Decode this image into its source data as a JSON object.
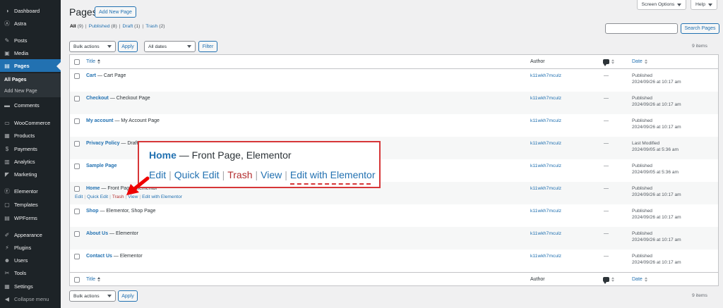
{
  "sidebar": {
    "items": [
      {
        "label": "Dashboard",
        "icon": "dashboard-icon",
        "glyph": "◑"
      },
      {
        "label": "Astra",
        "icon": "astra-icon",
        "glyph": "Ⓐ"
      },
      {
        "label": "Posts",
        "icon": "pin-icon",
        "glyph": "✎"
      },
      {
        "label": "Media",
        "icon": "media-icon",
        "glyph": "▣"
      },
      {
        "label": "Pages",
        "icon": "pages-icon",
        "glyph": "▤"
      },
      {
        "label": "Comments",
        "icon": "comments-icon",
        "glyph": "▬"
      },
      {
        "label": "WooCommerce",
        "icon": "woocommerce-icon",
        "glyph": "▭"
      },
      {
        "label": "Products",
        "icon": "products-icon",
        "glyph": "▦"
      },
      {
        "label": "Payments",
        "icon": "payments-icon",
        "glyph": "$"
      },
      {
        "label": "Analytics",
        "icon": "analytics-icon",
        "glyph": "▥"
      },
      {
        "label": "Marketing",
        "icon": "marketing-icon",
        "glyph": "◤"
      },
      {
        "label": "Elementor",
        "icon": "elementor-icon",
        "glyph": "Ⓔ"
      },
      {
        "label": "Templates",
        "icon": "templates-icon",
        "glyph": "▢"
      },
      {
        "label": "WPForms",
        "icon": "wpforms-icon",
        "glyph": "▤"
      },
      {
        "label": "Appearance",
        "icon": "appearance-icon",
        "glyph": "✐"
      },
      {
        "label": "Plugins",
        "icon": "plugins-icon",
        "glyph": "⚡"
      },
      {
        "label": "Users",
        "icon": "users-icon",
        "glyph": "☻"
      },
      {
        "label": "Tools",
        "icon": "tools-icon",
        "glyph": "✂"
      },
      {
        "label": "Settings",
        "icon": "settings-icon",
        "glyph": "▦"
      },
      {
        "label": "Collapse menu",
        "icon": "collapse-icon",
        "glyph": "◀"
      }
    ],
    "submenu": {
      "all_pages": "All Pages",
      "add_new": "Add New Page"
    }
  },
  "header": {
    "title": "Pages",
    "add_new": "Add New Page",
    "screen_options": "Screen Options",
    "help": "Help"
  },
  "filters": {
    "all": "All",
    "all_count": "(9)",
    "published": "Published",
    "published_count": "(8)",
    "draft": "Draft",
    "draft_count": "(1)",
    "trash": "Trash",
    "trash_count": "(2)",
    "sep": "|"
  },
  "search": {
    "placeholder": "",
    "button": "Search Pages"
  },
  "bulk": {
    "label": "Bulk actions",
    "apply": "Apply",
    "dates": "All dates",
    "filter": "Filter"
  },
  "items_count": "9 items",
  "table": {
    "columns": {
      "title": "Title",
      "author": "Author",
      "date": "Date"
    },
    "rows": [
      {
        "title": "Cart",
        "state": " — Cart Page",
        "author": "k11wkh7mculz",
        "comments": "—",
        "status": "Published",
        "date": "2024/09/26 at 10:17 am"
      },
      {
        "title": "Checkout",
        "state": " — Checkout Page",
        "author": "k11wkh7mculz",
        "comments": "—",
        "status": "Published",
        "date": "2024/09/26 at 10:17 am"
      },
      {
        "title": "My account",
        "state": " — My Account Page",
        "author": "k11wkh7mculz",
        "comments": "—",
        "status": "Published",
        "date": "2024/09/26 at 10:17 am"
      },
      {
        "title": "Privacy Policy",
        "state": " — Draft",
        "author": "k11wkh7mculz",
        "comments": "—",
        "status": "Last Modified",
        "date": "2024/09/05 at 5:36 am"
      },
      {
        "title": "Sample Page",
        "state": "",
        "author": "k11wkh7mculz",
        "comments": "—",
        "status": "Published",
        "date": "2024/09/05 at 5:36 am"
      },
      {
        "title": "Home",
        "state": " — Front Page, Elementor",
        "author": "k11wkh7mculz",
        "comments": "—",
        "status": "Published",
        "date": "2024/09/26 at 10:17 am"
      },
      {
        "title": "Shop",
        "state": " — Elementor, Shop Page",
        "author": "k11wkh7mculz",
        "comments": "—",
        "status": "Published",
        "date": "2024/09/26 at 10:17 am"
      },
      {
        "title": "About Us",
        "state": " — Elementor",
        "author": "k11wkh7mculz",
        "comments": "—",
        "status": "Published",
        "date": "2024/09/26 at 10:17 am"
      },
      {
        "title": "Contact Us",
        "state": " — Elementor",
        "author": "k11wkh7mculz",
        "comments": "—",
        "status": "Published",
        "date": "2024/09/26 at 10:17 am"
      }
    ],
    "row_actions": {
      "edit": "Edit",
      "quick_edit": "Quick Edit",
      "trash": "Trash",
      "view": "View",
      "edit_elementor": "Edit with Elementor",
      "sep": "|"
    }
  },
  "callout": {
    "title": "Home",
    "state": " — Front Page, Elementor",
    "edit": "Edit",
    "quick_edit": "Quick Edit",
    "trash": "Trash",
    "view": "View",
    "edit_elementor": "Edit with Elementor",
    "sep": "|"
  },
  "colors": {
    "accent": "#2271b1",
    "highlight": "#d63638",
    "sidebar": "#1d2327"
  }
}
